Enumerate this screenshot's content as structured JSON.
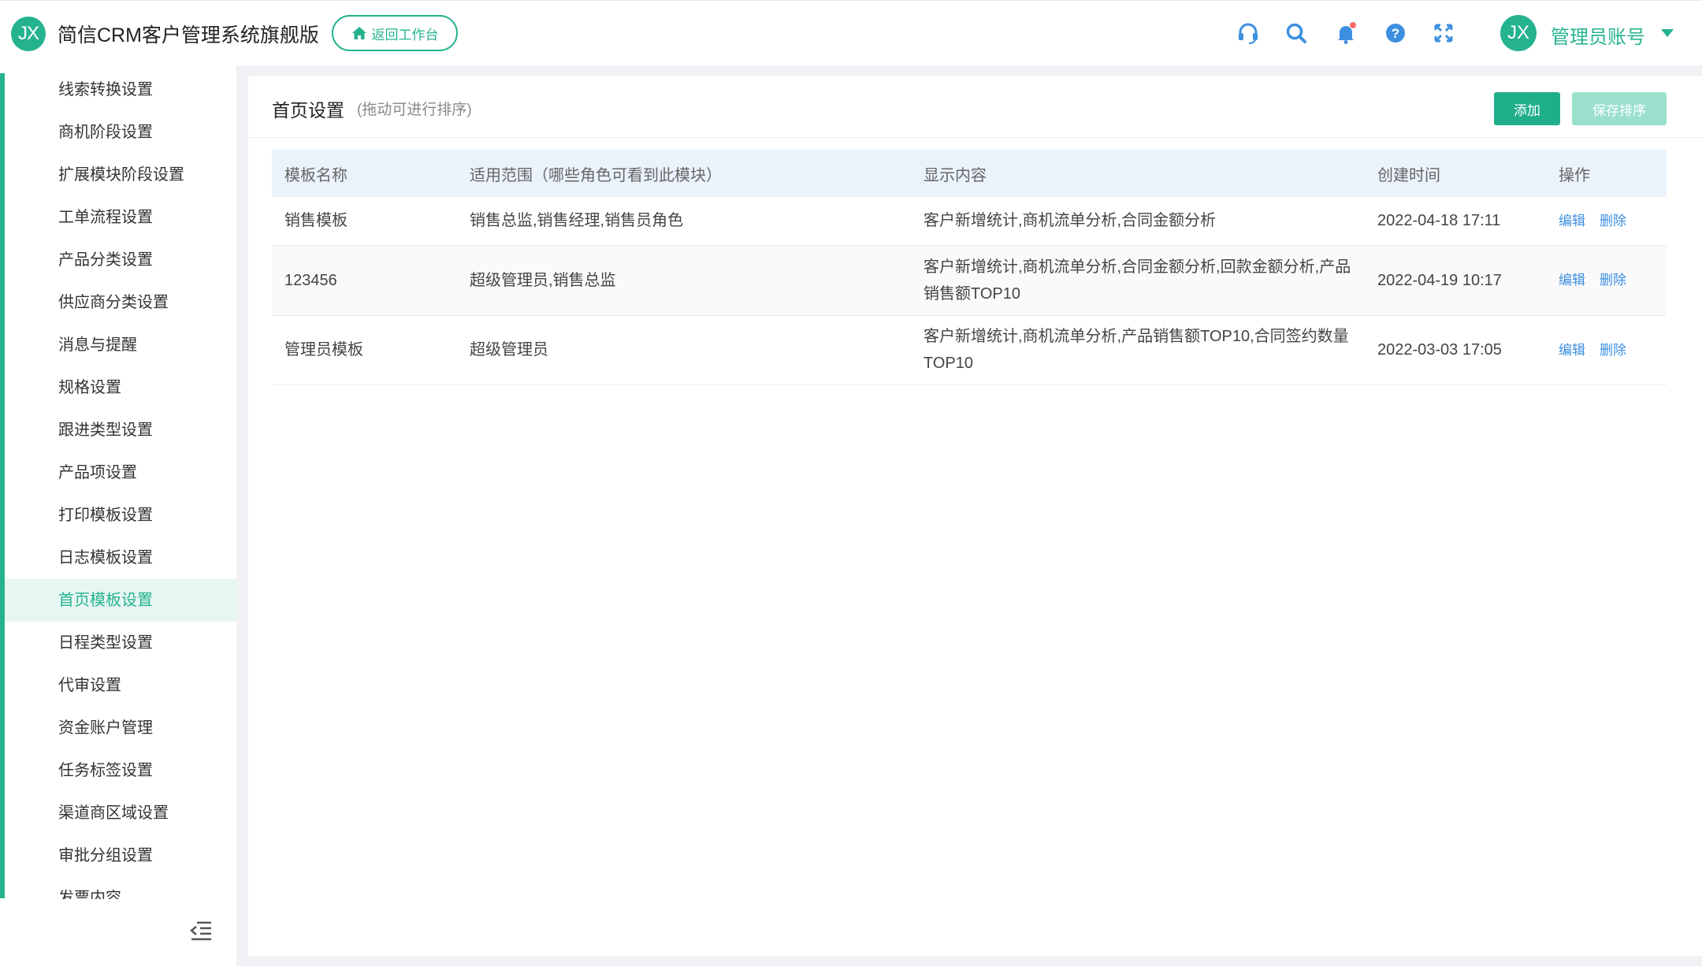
{
  "header": {
    "logo_text": "JX",
    "app_title": "简信CRM客户管理系统旗舰版",
    "back_button_label": "返回工作台",
    "avatar_text": "JX",
    "user_name": "管理员账号",
    "icons": [
      "headset-icon",
      "search-icon",
      "bell-icon",
      "help-icon",
      "fullscreen-icon"
    ],
    "accent_color": "#25b38f",
    "notification_dot_color": "#f56c6c"
  },
  "sidebar": {
    "items": [
      {
        "label": "线索转换设置"
      },
      {
        "label": "商机阶段设置"
      },
      {
        "label": "扩展模块阶段设置"
      },
      {
        "label": "工单流程设置"
      },
      {
        "label": "产品分类设置"
      },
      {
        "label": "供应商分类设置"
      },
      {
        "label": "消息与提醒"
      },
      {
        "label": "规格设置"
      },
      {
        "label": "跟进类型设置"
      },
      {
        "label": "产品项设置"
      },
      {
        "label": "打印模板设置"
      },
      {
        "label": "日志模板设置"
      },
      {
        "label": "首页模板设置",
        "active": true
      },
      {
        "label": "日程类型设置"
      },
      {
        "label": "代审设置"
      },
      {
        "label": "资金账户管理"
      },
      {
        "label": "任务标签设置"
      },
      {
        "label": "渠道商区域设置"
      },
      {
        "label": "审批分组设置"
      },
      {
        "label": "发票内容"
      }
    ],
    "collapse_icon": "menu-collapse-icon"
  },
  "main": {
    "title": "首页设置",
    "hint": "(拖动可进行排序)",
    "add_label": "添加",
    "save_sort_label": "保存排序",
    "table": {
      "headers": [
        "模板名称",
        "适用范围（哪些角色可看到此模块）",
        "显示内容",
        "创建时间",
        "操作"
      ],
      "rows": [
        {
          "name": "销售模板",
          "scope": "销售总监,销售经理,销售员角色",
          "content": "客户新增统计,商机流单分析,合同金额分析",
          "created": "2022-04-18 17:11",
          "edit": "编辑",
          "delete": "删除"
        },
        {
          "name": "123456",
          "scope": "超级管理员,销售总监",
          "content": "客户新增统计,商机流单分析,合同金额分析,回款金额分析,产品销售额TOP10",
          "created": "2022-04-19 10:17",
          "edit": "编辑",
          "delete": "删除"
        },
        {
          "name": "管理员模板",
          "scope": "超级管理员",
          "content": "客户新增统计,商机流单分析,产品销售额TOP10,合同签约数量TOP10",
          "created": "2022-03-03 17:05",
          "edit": "编辑",
          "delete": "删除"
        }
      ]
    }
  }
}
